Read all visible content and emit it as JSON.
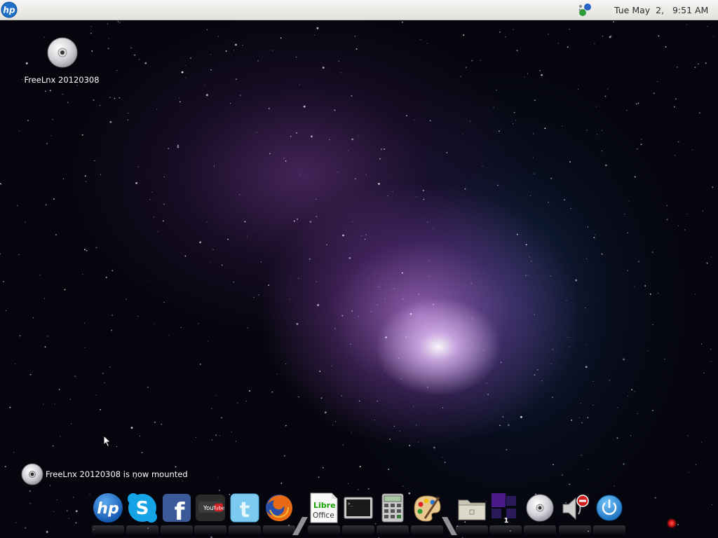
{
  "panel": {
    "menu_icon": "hp-logo-icon",
    "tray_icon": "network-status-icon",
    "clock": "Tue May  2,   9:51 AM"
  },
  "desktop": {
    "icons": [
      {
        "label": "FreeLnx 20120308",
        "icon": "cd-disc-icon"
      }
    ]
  },
  "notification": {
    "icon": "cd-disc-icon",
    "text": "FreeLnx 20120308 is now mounted"
  },
  "dock": {
    "items": [
      {
        "icon": "hp-icon"
      },
      {
        "icon": "skype-icon"
      },
      {
        "icon": "facebook-icon"
      },
      {
        "icon": "youtube-icon",
        "text": "You Tube"
      },
      {
        "icon": "twitter-icon"
      },
      {
        "icon": "firefox-icon"
      },
      {
        "icon": "libreoffice-icon",
        "text_top": "Libre",
        "text_bottom": "Office"
      },
      {
        "icon": "terminal-icon"
      },
      {
        "icon": "calculator-icon"
      },
      {
        "icon": "paint-palette-icon"
      },
      {
        "icon": "file-manager-folder-icon"
      },
      {
        "icon": "workspace-switcher-icon",
        "text": "1"
      },
      {
        "icon": "cd-disc-icon"
      },
      {
        "icon": "volume-muted-icon"
      },
      {
        "icon": "power-icon"
      }
    ]
  },
  "colors": {
    "panel_bg": "#eeede9",
    "hp_blue": "#1e6fc8",
    "facebook_blue": "#3b5998",
    "youtube_red": "#d22020",
    "twitter_blue": "#6fc4ea"
  }
}
